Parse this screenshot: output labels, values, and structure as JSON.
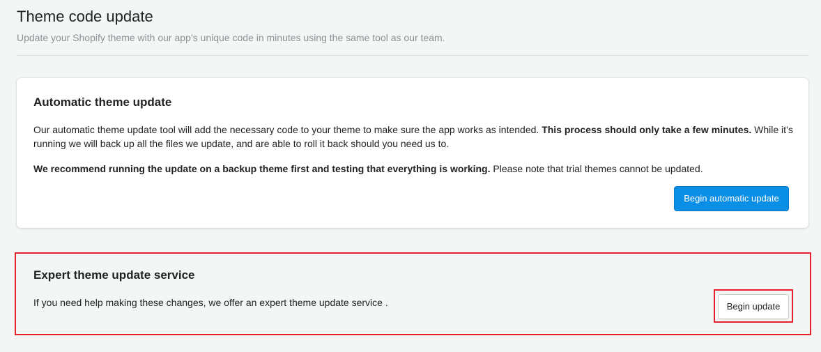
{
  "header": {
    "title": "Theme code update",
    "subtitle": "Update your Shopify theme with our app’s unique code in minutes using the same tool as our team."
  },
  "automatic_card": {
    "title": "Automatic theme update",
    "paragraph1_part1": "Our automatic theme update tool will add the necessary code to your theme to make sure the app works as intended. ",
    "paragraph1_bold": "This process should only take a few minutes.",
    "paragraph1_part2": " While it’s running we will back up all the files we update, and are able to roll it back should you need us to.",
    "paragraph2_bold": "We recommend running the update on a backup theme first and testing that everything is working.",
    "paragraph2_part2": " Please note that trial themes cannot be updated.",
    "button_label": "Begin automatic update"
  },
  "expert_section": {
    "title": "Expert theme update service",
    "text": "If you need help making these changes, we offer an expert theme update service .",
    "button_label": "Begin update"
  },
  "colors": {
    "background": "#f4f6f6",
    "primary_button": "#0a8ee6",
    "highlight_border": "#e3202b"
  }
}
